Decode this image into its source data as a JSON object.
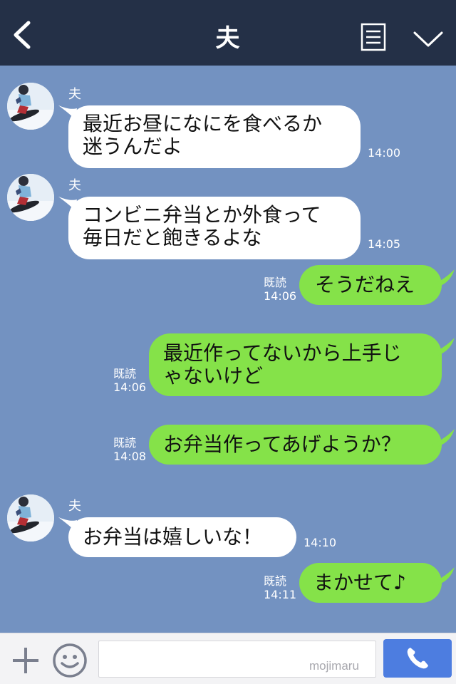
{
  "header": {
    "title": "夫",
    "back_icon": "chevron-left-icon",
    "menu_icon": "notes-menu-icon",
    "toggle_icon": "chevron-down-icon",
    "background": "#243047"
  },
  "colors": {
    "chat_background": "#7392c1",
    "incoming_bubble": "#ffffff",
    "outgoing_bubble": "#85e249",
    "call_button": "#4d7de0"
  },
  "messages": [
    {
      "sender": "夫",
      "lines": [
        "最近お昼になにを食べるか",
        "迷うんだよ"
      ],
      "time": "14:00"
    },
    {
      "sender": "夫",
      "lines": [
        "コンビニ弁当とか外食って",
        "毎日だと飽きるよな"
      ],
      "time": "14:05"
    },
    {
      "read": "既読",
      "lines": [
        "そうだねえ"
      ],
      "time": "14:06"
    },
    {
      "read": "既読",
      "lines": [
        "最近作ってないから上手じ",
        "ゃないけど"
      ],
      "time": "14:06"
    },
    {
      "read": "既読",
      "lines": [
        "お弁当作ってあげようか？"
      ],
      "time": "14:08"
    },
    {
      "sender": "夫",
      "lines": [
        "お弁当は嬉しいな！"
      ],
      "time": "14:10"
    },
    {
      "read": "既読",
      "lines": [
        "まかせて♪"
      ],
      "time": "14:11"
    }
  ],
  "footer": {
    "plus_icon": "plus-icon",
    "emoji_icon": "smiley-icon",
    "input_value": "",
    "watermark": "mojimaru",
    "call_icon": "phone-icon"
  }
}
